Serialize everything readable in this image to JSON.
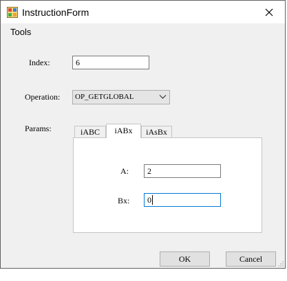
{
  "background": {
    "left_text": "",
    "right_text": ""
  },
  "window": {
    "title": "InstructionForm",
    "menu": [
      "Tools"
    ]
  },
  "form": {
    "index_label": "Index:",
    "index_value": "6",
    "operation_label": "Operation:",
    "operation_value": "OP_GETGLOBAL",
    "params_label": "Params:",
    "tabs": [
      "iABC",
      "iABx",
      "iAsBx"
    ],
    "active_tab": "iABx",
    "a_label": "A:",
    "a_value": "2",
    "bx_label": "Bx:",
    "bx_value": "0"
  },
  "buttons": {
    "ok": "OK",
    "cancel": "Cancel"
  },
  "colors": {
    "window_bg": "#f0f0f0",
    "titlebar_bg": "#ffffff",
    "field_border": "#7a7a7a",
    "button_bg": "#e1e1e1"
  }
}
